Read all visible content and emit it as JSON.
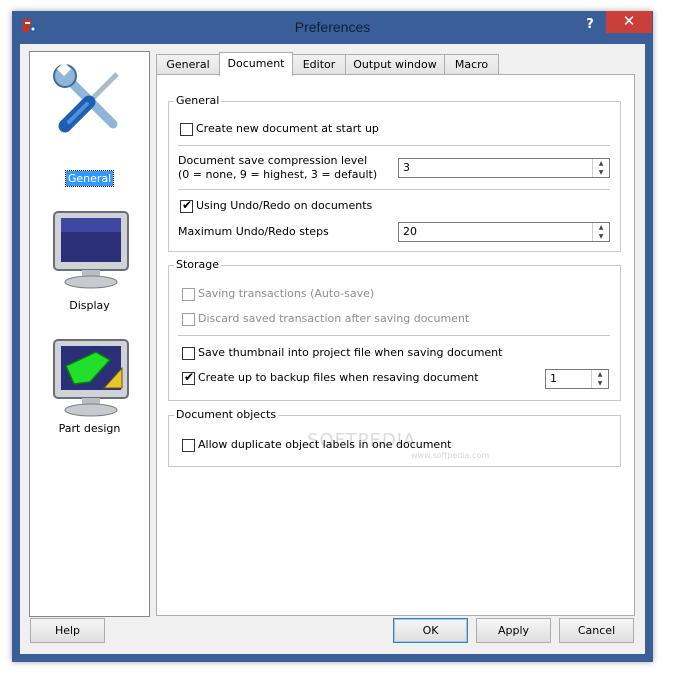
{
  "window": {
    "title": "Preferences",
    "help_glyph": "?",
    "close_glyph": "✕"
  },
  "sidebar": {
    "items": [
      {
        "label": "General",
        "icon": "tools-icon",
        "selected": true
      },
      {
        "label": "Display",
        "icon": "monitor-icon",
        "selected": false
      },
      {
        "label": "Part design",
        "icon": "part-design-icon",
        "selected": false
      }
    ]
  },
  "tabs": [
    {
      "label": "General"
    },
    {
      "label": "Document",
      "active": true
    },
    {
      "label": "Editor"
    },
    {
      "label": "Output window"
    },
    {
      "label": "Macro"
    }
  ],
  "general_group": {
    "title": "General",
    "create_new_doc": {
      "label": "Create new document at start up",
      "checked": false
    },
    "compression": {
      "label_line1": "Document save compression level",
      "label_line2": "(0 = none, 9 = highest, 3 = default)",
      "value": "3"
    },
    "undo_redo": {
      "label": "Using Undo/Redo on documents",
      "checked": true
    },
    "max_undo": {
      "label": "Maximum Undo/Redo steps",
      "value": "20"
    }
  },
  "storage_group": {
    "title": "Storage",
    "autosave": {
      "label": "Saving transactions (Auto-save)",
      "checked": false,
      "enabled": false
    },
    "discard": {
      "label": "Discard saved transaction after saving document",
      "checked": false,
      "enabled": false
    },
    "thumbnail": {
      "label": "Save thumbnail into project file when saving document",
      "checked": false
    },
    "backup": {
      "label": "Create up to backup files when resaving document",
      "checked": true,
      "value": "1"
    }
  },
  "objects_group": {
    "title": "Document objects",
    "duplicate_labels": {
      "label": "Allow duplicate object labels in one document",
      "checked": false
    }
  },
  "buttons": {
    "help": "Help",
    "ok": "OK",
    "apply": "Apply",
    "cancel": "Cancel"
  },
  "watermark": {
    "main": "SOFTPEDIA",
    "sub": "www.softpedia.com"
  },
  "colors": {
    "title_bar": "#3a5f98",
    "close_button": "#c9403a",
    "selection": "#3399ff"
  }
}
